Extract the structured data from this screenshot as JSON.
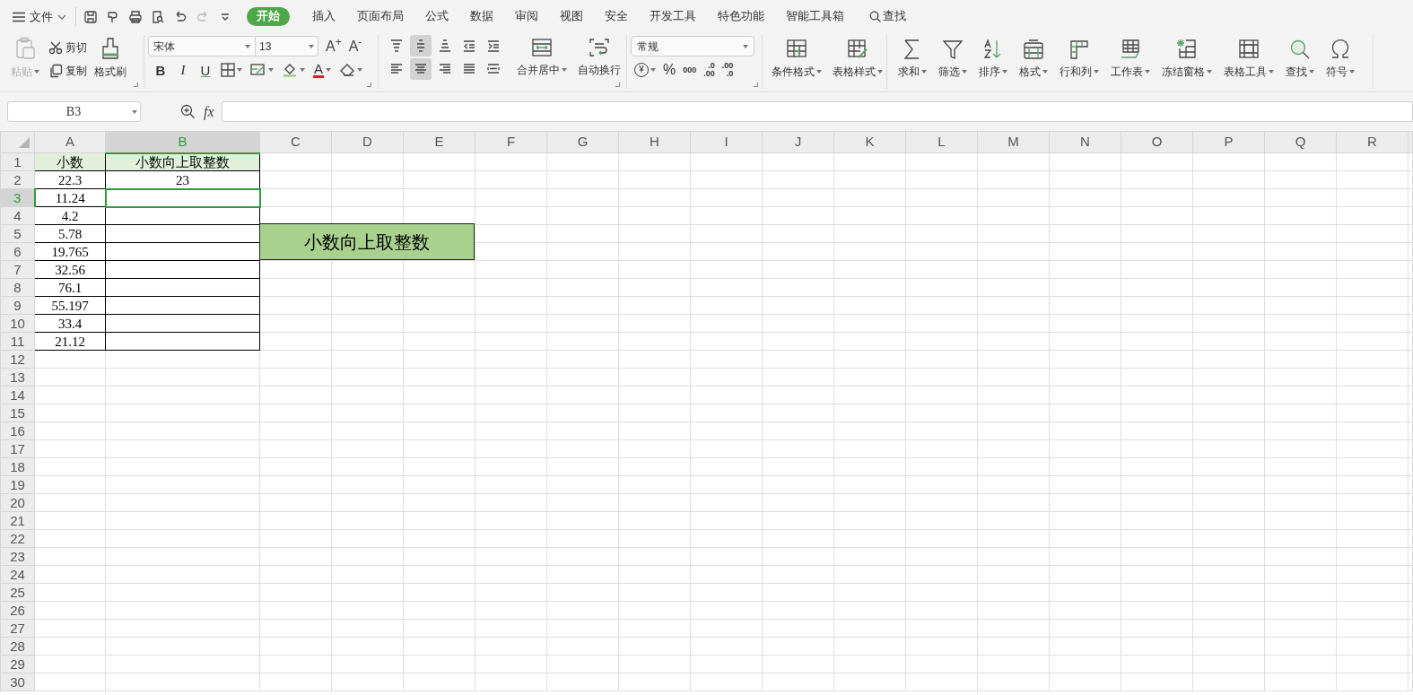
{
  "menu_bar": {
    "file_menu": "文件",
    "tabs": [
      {
        "label": "开始",
        "selected": true
      },
      {
        "label": "插入",
        "selected": false
      },
      {
        "label": "页面布局",
        "selected": false
      },
      {
        "label": "公式",
        "selected": false
      },
      {
        "label": "数据",
        "selected": false
      },
      {
        "label": "审阅",
        "selected": false
      },
      {
        "label": "视图",
        "selected": false
      },
      {
        "label": "安全",
        "selected": false
      },
      {
        "label": "开发工具",
        "selected": false
      },
      {
        "label": "特色功能",
        "selected": false
      },
      {
        "label": "智能工具箱",
        "selected": false
      }
    ],
    "search": "查找"
  },
  "ribbon": {
    "clipboard": {
      "paste": {
        "label": "粘贴",
        "disabled": true
      },
      "cut": "剪切",
      "copy": "复制",
      "format_painter": "格式刷"
    },
    "font": {
      "font_name": "宋体",
      "font_size": "13",
      "increase_font": "A$^{+}$",
      "decrease_font": "A$^{-}$",
      "format_buttons": [
        "B",
        "I",
        "U"
      ],
      "font_color": "A"
    },
    "alignment": {
      "align_buttons": [
        {
          "selected": false
        },
        {
          "selected": true
        },
        {
          "selected": false
        },
        {
          "selected": false
        },
        {
          "selected": false
        },
        {
          "selected": false
        },
        {
          "selected": true
        },
        {
          "selected": false
        },
        {
          "selected": false
        },
        {
          "selected": false
        }
      ],
      "merge": "合并居中",
      "wrap": "自动换行"
    },
    "number": {
      "format": "常规",
      "currency": "¥",
      "percent": "%",
      "thousands": "000",
      "decimal_increase": [
        ".0",
        ".00"
      ],
      "decimal_decrease": [
        ".00",
        ".0"
      ]
    },
    "styles": [
      "条件格式",
      "表格样式"
    ],
    "tools": [
      "求和",
      "筛选",
      "排序",
      "格式",
      "行和列",
      "工作表",
      "冻结窗格",
      "表格工具",
      "查找",
      "符号"
    ]
  },
  "formula_bar": {
    "name_box": "B3",
    "fx": "fx"
  },
  "sheet": {
    "columns": [
      {
        "label": "A",
        "selected": false
      },
      {
        "label": "B",
        "selected": true
      },
      {
        "label": "C",
        "selected": false
      },
      {
        "label": "D",
        "selected": false
      },
      {
        "label": "E",
        "selected": false
      },
      {
        "label": "F",
        "selected": false
      },
      {
        "label": "G",
        "selected": false
      },
      {
        "label": "H",
        "selected": false
      },
      {
        "label": "I",
        "selected": false
      },
      {
        "label": "J",
        "selected": false
      },
      {
        "label": "K",
        "selected": false
      },
      {
        "label": "L",
        "selected": false
      },
      {
        "label": "M",
        "selected": false
      },
      {
        "label": "N",
        "selected": false
      },
      {
        "label": "O",
        "selected": false
      },
      {
        "label": "P",
        "selected": false
      },
      {
        "label": "Q",
        "selected": false
      },
      {
        "label": "R",
        "selected": false
      }
    ],
    "rows": [
      {
        "number": "1",
        "selected": false,
        "kind": "header",
        "cells": [
          "小数",
          "小数向上取整数"
        ]
      },
      {
        "number": "2",
        "selected": false,
        "kind": "data",
        "cells": [
          "22.3",
          "23"
        ]
      },
      {
        "number": "3",
        "selected": true,
        "kind": "data",
        "cells": [
          "11.24"
        ]
      },
      {
        "number": "4",
        "selected": false,
        "kind": "data",
        "cells": [
          "4.2"
        ]
      },
      {
        "number": "5",
        "selected": false,
        "kind": "data",
        "cells": [
          "5.78"
        ]
      },
      {
        "number": "6",
        "selected": false,
        "kind": "data",
        "cells": [
          "19.765"
        ]
      },
      {
        "number": "7",
        "selected": false,
        "kind": "data",
        "cells": [
          "32.56"
        ]
      },
      {
        "number": "8",
        "selected": false,
        "kind": "data",
        "cells": [
          "76.1"
        ]
      },
      {
        "number": "9",
        "selected": false,
        "kind": "data",
        "cells": [
          "55.197"
        ]
      },
      {
        "number": "10",
        "selected": false,
        "kind": "data",
        "cells": [
          "33.4"
        ]
      },
      {
        "number": "11",
        "selected": false,
        "kind": "data",
        "cells": [
          "21.12"
        ]
      },
      {
        "number": "12",
        "selected": false,
        "kind": "empty"
      },
      {
        "number": "13",
        "selected": false,
        "kind": "empty"
      },
      {
        "number": "14",
        "selected": false,
        "kind": "empty"
      },
      {
        "number": "15",
        "selected": false,
        "kind": "empty"
      },
      {
        "number": "16",
        "selected": false,
        "kind": "empty"
      },
      {
        "number": "17",
        "selected": false,
        "kind": "empty"
      },
      {
        "number": "18",
        "selected": false,
        "kind": "empty"
      },
      {
        "number": "19",
        "selected": false,
        "kind": "empty"
      },
      {
        "number": "20",
        "selected": false,
        "kind": "empty"
      },
      {
        "number": "21",
        "selected": false,
        "kind": "empty"
      },
      {
        "number": "22",
        "selected": false,
        "kind": "empty"
      },
      {
        "number": "23",
        "selected": false,
        "kind": "empty"
      },
      {
        "number": "24",
        "selected": false,
        "kind": "empty"
      },
      {
        "number": "25",
        "selected": false,
        "kind": "empty"
      },
      {
        "number": "26",
        "selected": false,
        "kind": "empty"
      },
      {
        "number": "27",
        "selected": false,
        "kind": "empty"
      },
      {
        "number": "28",
        "selected": false,
        "kind": "empty"
      },
      {
        "number": "29",
        "selected": false,
        "kind": "empty"
      },
      {
        "number": "30",
        "selected": false,
        "kind": "empty"
      }
    ],
    "text_box": "小数向上取整数"
  }
}
